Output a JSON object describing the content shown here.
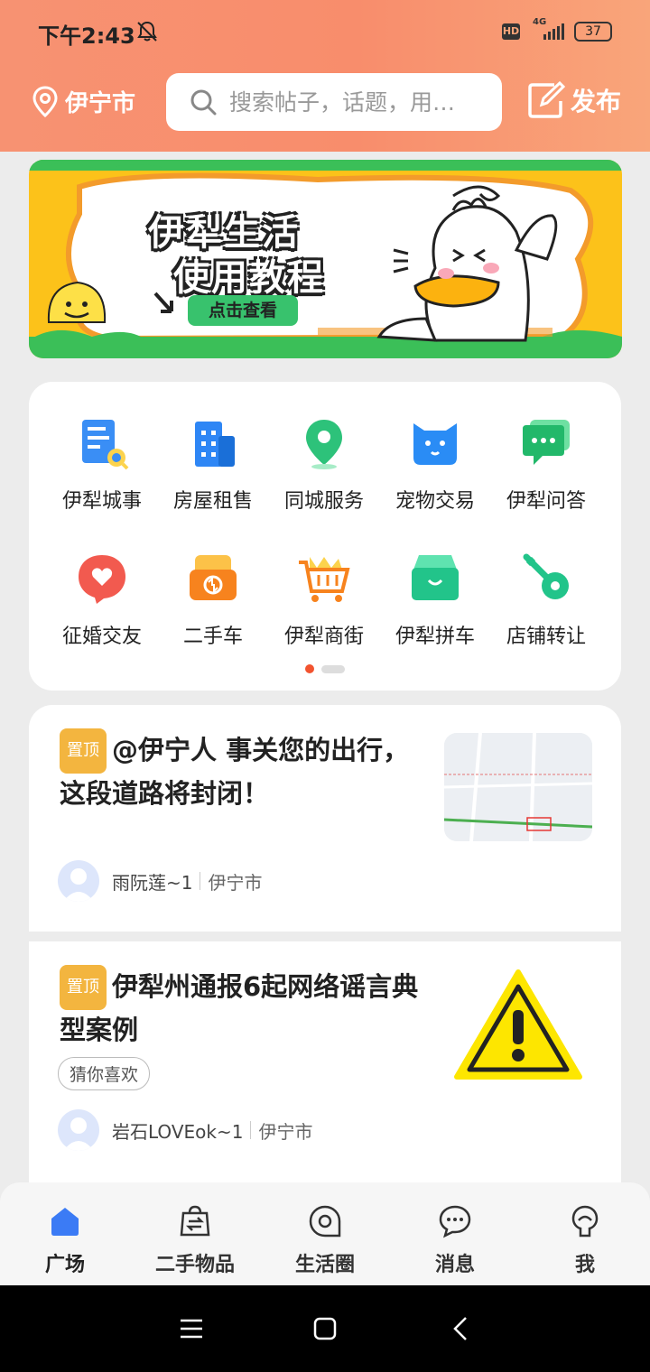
{
  "status": {
    "time": "下午2:43",
    "hd": "HD",
    "network": "4G",
    "battery": "37"
  },
  "header": {
    "location": "伊宁市",
    "search_placeholder": "搜索帖子，话题，用…",
    "publish_label": "发布"
  },
  "banner": {
    "title_line1": "伊犁生活",
    "title_line2": "使用教程",
    "button_label": "点击查看"
  },
  "grid": {
    "items": [
      {
        "label": "伊犁城事",
        "icon": "document-icon"
      },
      {
        "label": "房屋租售",
        "icon": "building-icon"
      },
      {
        "label": "同城服务",
        "icon": "location-pin-icon"
      },
      {
        "label": "宠物交易",
        "icon": "cat-icon"
      },
      {
        "label": "伊犁问答",
        "icon": "chat-bubble-icon"
      },
      {
        "label": "征婚交友",
        "icon": "heart-bubble-icon"
      },
      {
        "label": "二手车",
        "icon": "car-icon"
      },
      {
        "label": "伊犁商街",
        "icon": "cart-icon"
      },
      {
        "label": "伊犁拼车",
        "icon": "van-icon"
      },
      {
        "label": "店铺转让",
        "icon": "key-icon"
      }
    ]
  },
  "posts": [
    {
      "pin": "置顶",
      "title": "@伊宁人 事关您的出行，这段道路将封闭！",
      "author": "雨阮莲~1",
      "city": "伊宁市"
    },
    {
      "pin": "置顶",
      "title": "伊犁州通报6起网络谣言典型案例",
      "tag": "猜你喜欢",
      "author": "岩石LOVEok~1",
      "city": "伊宁市"
    }
  ],
  "tabbar": {
    "tabs": [
      {
        "label": "广场",
        "icon": "home-icon",
        "active": true
      },
      {
        "label": "二手物品",
        "icon": "exchange-bag-icon"
      },
      {
        "label": "生活圈",
        "icon": "circle-chat-icon"
      },
      {
        "label": "消息",
        "icon": "message-icon"
      },
      {
        "label": "我",
        "icon": "profile-icon"
      }
    ]
  },
  "colors": {
    "accent": "#f2532f",
    "header_bg": "#f88d6c",
    "pin": "#f3b53f",
    "tab_active": "#3b7bf5"
  }
}
